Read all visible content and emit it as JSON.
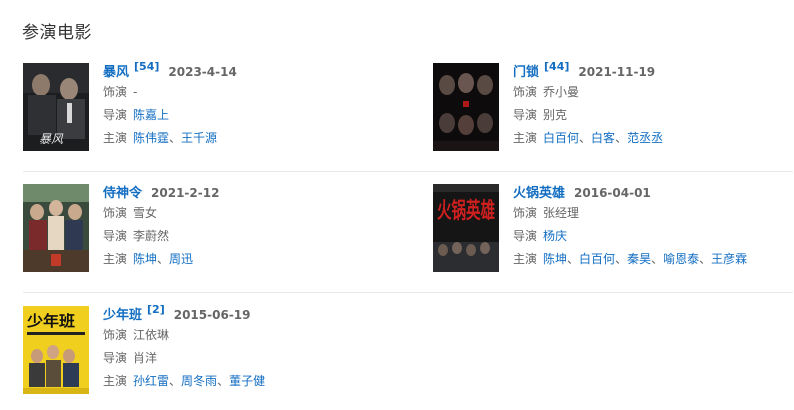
{
  "section": {
    "title": "参演电影"
  },
  "movies": [
    {
      "title": "暴风",
      "count": "[54]",
      "date": "2023-4-14",
      "role_label": "饰演",
      "role": "-",
      "director_label": "导演",
      "director": "陈嘉上",
      "cast_label": "主演",
      "cast": [
        "陈伟霆",
        "王千源"
      ],
      "poster_text": "暴风"
    },
    {
      "title": "门锁",
      "count": "[44]",
      "date": "2021-11-19",
      "role_label": "饰演",
      "role": "乔小曼",
      "director_label": "导演",
      "director": "别克",
      "cast_label": "主演",
      "cast": [
        "白百何",
        "白客",
        "范丞丞"
      ],
      "poster_text": ""
    },
    {
      "title": "侍神令",
      "count": "",
      "date": "2021-2-12",
      "role_label": "饰演",
      "role": "雪女",
      "director_label": "导演",
      "director": "李蔚然",
      "cast_label": "主演",
      "cast": [
        "陈坤",
        "周迅"
      ],
      "poster_text": ""
    },
    {
      "title": "火锅英雄",
      "count": "",
      "date": "2016-04-01",
      "role_label": "饰演",
      "role": "张经理",
      "director_label": "导演",
      "director": "杨庆",
      "cast_label": "主演",
      "cast": [
        "陈坤",
        "白百何",
        "秦昊",
        "喻恩泰",
        "王彦霖"
      ],
      "poster_text": "火锅英雄"
    },
    {
      "title": "少年班",
      "count": "[2]",
      "date": "2015-06-19",
      "role_label": "饰演",
      "role": "江依琳",
      "director_label": "导演",
      "director": "肖洋",
      "cast_label": "主演",
      "cast": [
        "孙红雷",
        "周冬雨",
        "董子健"
      ],
      "poster_text": "少年班"
    }
  ]
}
